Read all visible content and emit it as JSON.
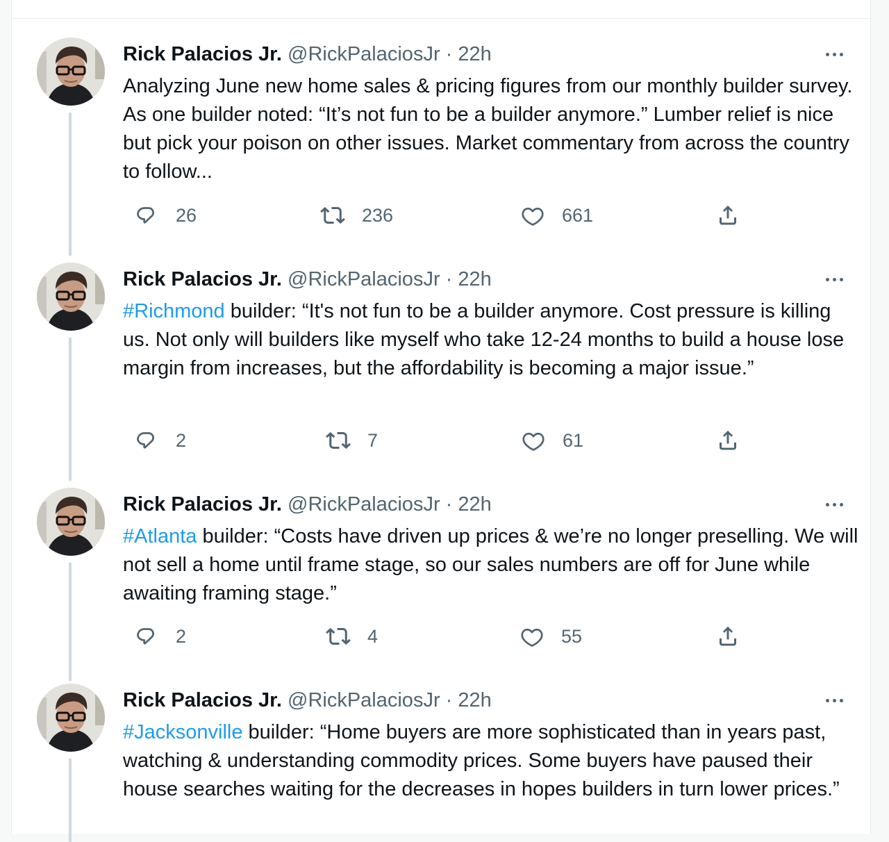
{
  "tweets": [
    {
      "name": "Rick Palacios Jr.",
      "handle": "@RickPalaciosJr",
      "separator": "·",
      "time": "22h",
      "hashtag": "",
      "text": "Analyzing June new home sales & pricing figures from our monthly builder survey. As one builder noted: “It’s not fun to be a builder anymore.” Lumber relief is nice but pick your poison on other issues. Market commentary from across the country to follow...",
      "replies": "26",
      "retweets": "236",
      "likes": "661"
    },
    {
      "name": "Rick Palacios Jr.",
      "handle": "@RickPalaciosJr",
      "separator": "·",
      "time": "22h",
      "hashtag": "#Richmond",
      "text": " builder: “It's not fun to be a builder anymore. Cost pressure is killing us. Not only will builders like myself who take 12-24 months to build a house lose margin from increases, but the affordability is becoming a major issue.”",
      "replies": "2",
      "retweets": "7",
      "likes": "61"
    },
    {
      "name": "Rick Palacios Jr.",
      "handle": "@RickPalaciosJr",
      "separator": "·",
      "time": "22h",
      "hashtag": "#Atlanta",
      "text": " builder: “Costs have driven up prices & we’re no longer preselling. We will not sell a home until frame stage, so our sales numbers are off for June while awaiting framing stage.”",
      "replies": "2",
      "retweets": "4",
      "likes": "55"
    },
    {
      "name": "Rick Palacios Jr.",
      "handle": "@RickPalaciosJr",
      "separator": "·",
      "time": "22h",
      "hashtag": "#Jacksonville",
      "text": " builder: “Home buyers are more sophisticated than in years past, watching & understanding commodity prices. Some buyers have paused their house searches waiting for the decreases in hopes builders in turn lower prices.”",
      "replies": "",
      "retweets": "",
      "likes": ""
    }
  ],
  "colors": {
    "hashtag": "#1d9bf0",
    "secondary_text": "#536471",
    "thread_line": "#cfd9de"
  },
  "icons": {
    "reply": "reply-icon",
    "retweet": "retweet-icon",
    "like": "heart-icon",
    "share": "share-icon",
    "more": "more-icon"
  }
}
